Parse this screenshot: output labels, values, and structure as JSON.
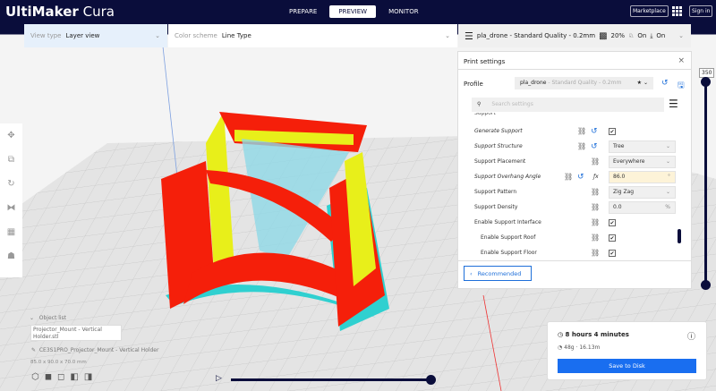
{
  "header": {
    "logo_bold": "UltiMaker",
    "logo_light": " Cura",
    "tabs": [
      "PREPARE",
      "PREVIEW",
      "MONITOR"
    ],
    "active_tab": "PREVIEW",
    "marketplace": "Marketplace",
    "sign_in": "Sign in"
  },
  "toolbar": {
    "view_type_label": "View type",
    "view_type": "Layer view",
    "color_scheme_label": "Color scheme",
    "color_scheme": "Line Type",
    "profile_summary": "pla_drone - Standard Quality - 0.2mm",
    "infill": "20%",
    "support": "On",
    "adhesion": "On"
  },
  "print_settings": {
    "title": "Print settings",
    "close": "×",
    "profile_label": "Profile",
    "profile_name": "pla_drone",
    "profile_quality": " - Standard Quality - 0.2mm",
    "search_placeholder": "Search settings",
    "category": "Support",
    "rows": [
      {
        "name": "Generate Support",
        "type": "check",
        "value": "✔"
      },
      {
        "name": "Support Structure",
        "type": "select",
        "value": "Tree"
      },
      {
        "name": "Support Placement",
        "type": "select",
        "value": "Everywhere"
      },
      {
        "name": "Support Overhang Angle",
        "type": "text",
        "value": "86.0",
        "unit": "°"
      },
      {
        "name": "Support Pattern",
        "type": "select",
        "value": "Zig Zag"
      },
      {
        "name": "Support Density",
        "type": "text",
        "value": "0.0",
        "unit": "%"
      },
      {
        "name": "Enable Support Interface",
        "type": "check",
        "value": "✔"
      },
      {
        "name": "Enable Support Roof",
        "type": "check",
        "value": "✔"
      },
      {
        "name": "Enable Support Floor",
        "type": "check",
        "value": "✔"
      }
    ],
    "recommended": "Recommended"
  },
  "layer_slider": {
    "max_label": "350",
    "value_fraction": 1.0
  },
  "object_list": {
    "title": "Object list",
    "file": "Projector_Mount - Vertical Holder.stl",
    "object_name": "CE3S1PRO_Projector_Mount - Vertical Holder",
    "dimensions": "85.0 x 90.0 x 70.0 mm"
  },
  "summary": {
    "time": "8 hours 4 minutes",
    "material": "48g · 16.13m",
    "save": "Save to Disk"
  },
  "playback": {
    "progress": 1.0
  }
}
